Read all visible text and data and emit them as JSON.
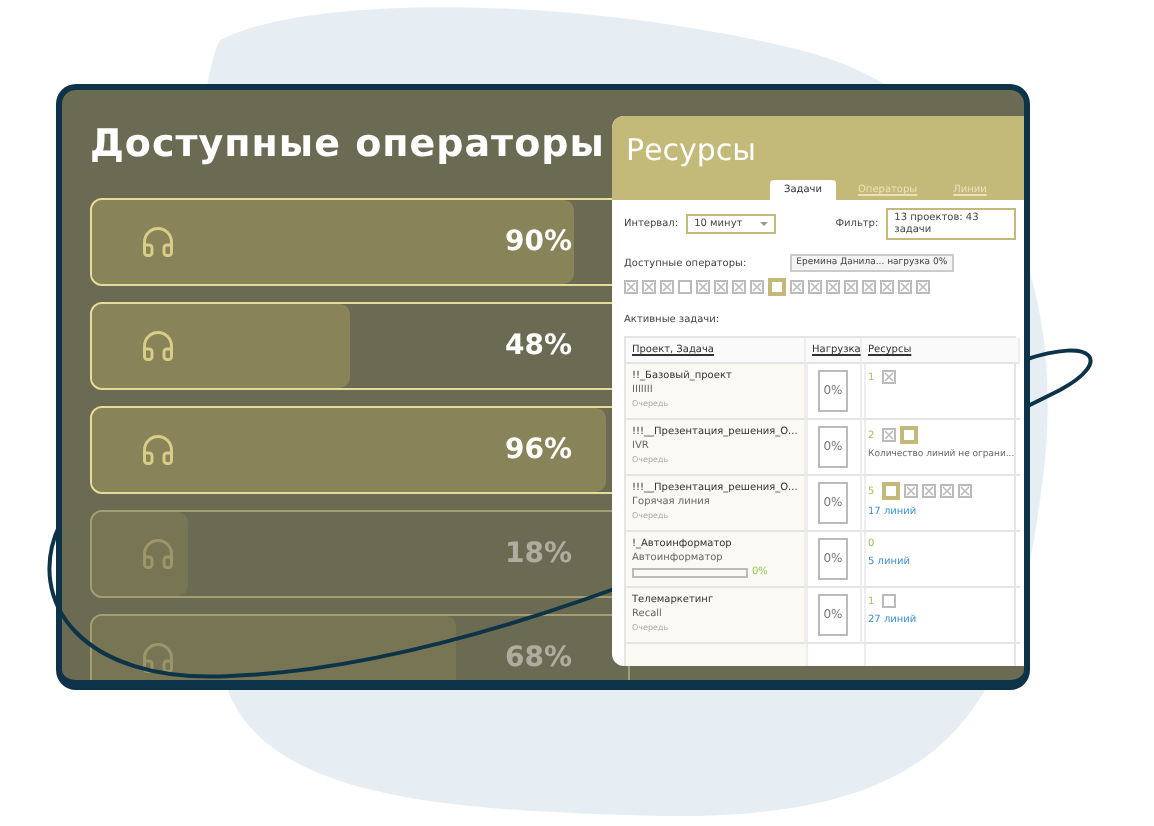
{
  "title": "Доступные операторы",
  "operators": [
    {
      "reading": "90%",
      "level": 0.9,
      "dimmed": false
    },
    {
      "reading": "48%",
      "level": 0.48,
      "dimmed": false
    },
    {
      "reading": "96%",
      "level": 0.96,
      "dimmed": false
    },
    {
      "reading": "18%",
      "level": 0.18,
      "dimmed": true
    },
    {
      "reading": "68%",
      "level": 0.68,
      "dimmed": true
    }
  ],
  "resources": {
    "title": "Ресурсы",
    "tabs": [
      {
        "label": "Задачи",
        "selected": true
      },
      {
        "label": "Операторы",
        "selected": false
      },
      {
        "label": "Линии",
        "selected": false
      }
    ],
    "interval": {
      "label": "Интервал:",
      "value": "10 минут"
    },
    "filter": {
      "label": "Фильтр:",
      "value": "13 проектов: 43 задачи"
    },
    "operators": {
      "label": "Доступные операторы:",
      "tooltip": {
        "name": "Еремина Данила...",
        "load": "нагрузка 0%"
      },
      "slots": [
        {
          "kind": "x"
        },
        {
          "kind": "x"
        },
        {
          "kind": "x"
        },
        {
          "kind": "empty"
        },
        {
          "kind": "x"
        },
        {
          "kind": "x"
        },
        {
          "kind": "x"
        },
        {
          "kind": "x"
        },
        {
          "kind": "selected"
        },
        {
          "kind": "x"
        },
        {
          "kind": "x"
        },
        {
          "kind": "x"
        },
        {
          "kind": "x"
        },
        {
          "kind": "x"
        },
        {
          "kind": "x"
        },
        {
          "kind": "x"
        },
        {
          "kind": "x"
        }
      ]
    },
    "tasks": {
      "label": "Активные задачи:",
      "columns": [
        "Проект, Задача",
        "Нагрузка",
        "Ресурсы"
      ],
      "rows": [
        {
          "project": "!!_Базовый_проект",
          "task": "IIIIIII",
          "kind": "status",
          "status": "Очередь",
          "load": "0%",
          "count": "1",
          "slots": [
            {
              "kind": "x"
            }
          ]
        },
        {
          "project": "!!!__Презентация_решения_О...",
          "task": "IVR",
          "kind": "status",
          "status": "Очередь",
          "load": "0%",
          "count": "2",
          "slots": [
            {
              "kind": "x"
            },
            {
              "kind": "selected"
            }
          ],
          "note": "Количество линий не ограни..."
        },
        {
          "project": "!!!__Презентация_решения_О...",
          "task": "Горячая линия",
          "kind": "status",
          "status": "Очередь",
          "load": "0%",
          "count": "5",
          "slots": [
            {
              "kind": "selected"
            },
            {
              "kind": "x"
            },
            {
              "kind": "x"
            },
            {
              "kind": "x"
            },
            {
              "kind": "x"
            }
          ],
          "link": "17 линий"
        },
        {
          "project": "!_Автоинформатор",
          "task": "Автоинформатор",
          "kind": "progress",
          "level": 0,
          "reading": "0%",
          "load": "0%",
          "count": "0",
          "slots": [],
          "link": "5 линий"
        },
        {
          "project": "Телемаркетинг",
          "task": "Recall",
          "kind": "status",
          "status": "Очередь",
          "load": "0%",
          "count": "1",
          "slots": [
            {
              "kind": "empty"
            }
          ],
          "link": "27 линий"
        }
      ]
    }
  }
}
